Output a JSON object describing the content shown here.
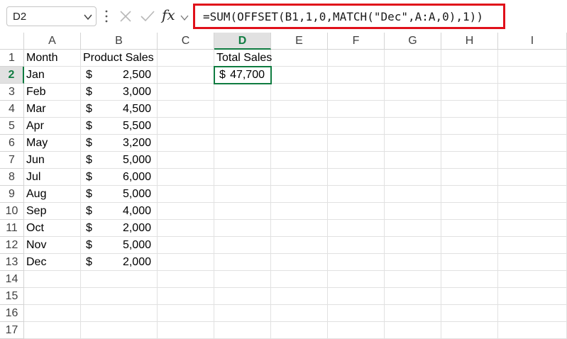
{
  "formula_bar": {
    "name_box": "D2",
    "fx_label": "fx",
    "formula": "=SUM(OFFSET(B1,1,0,MATCH(\"Dec\",A:A,0),1))"
  },
  "columns": [
    "A",
    "B",
    "C",
    "D",
    "E",
    "F",
    "G",
    "H",
    "I"
  ],
  "selected_column": "D",
  "rows": [
    "1",
    "2",
    "3",
    "4",
    "5",
    "6",
    "7",
    "8",
    "9",
    "10",
    "11",
    "12",
    "13",
    "14",
    "15",
    "16",
    "17"
  ],
  "selected_row": "2",
  "headers": {
    "A1": "Month",
    "B1": "Product Sales",
    "D1": "Total Sales"
  },
  "total": {
    "currency": "$",
    "value": "47,700"
  },
  "data": [
    {
      "month": "Jan",
      "currency": "$",
      "sales": "2,500"
    },
    {
      "month": "Feb",
      "currency": "$",
      "sales": "3,000"
    },
    {
      "month": "Mar",
      "currency": "$",
      "sales": "4,500"
    },
    {
      "month": "Apr",
      "currency": "$",
      "sales": "5,500"
    },
    {
      "month": "May",
      "currency": "$",
      "sales": "3,200"
    },
    {
      "month": "Jun",
      "currency": "$",
      "sales": "5,000"
    },
    {
      "month": "Jul",
      "currency": "$",
      "sales": "6,000"
    },
    {
      "month": "Aug",
      "currency": "$",
      "sales": "5,000"
    },
    {
      "month": "Sep",
      "currency": "$",
      "sales": "4,000"
    },
    {
      "month": "Oct",
      "currency": "$",
      "sales": "2,000"
    },
    {
      "month": "Nov",
      "currency": "$",
      "sales": "5,000"
    },
    {
      "month": "Dec",
      "currency": "$",
      "sales": "2,000"
    }
  ],
  "icons": {
    "name_box_dropdown": "chevron-down-icon",
    "more": "vertical-dots-icon",
    "cancel": "cancel-x-icon",
    "enter": "checkmark-icon",
    "insert_function": "fx-icon",
    "formula_expand": "chevron-down-icon"
  },
  "colors": {
    "highlight_border": "#e0101a",
    "selection_green": "#107c41"
  }
}
